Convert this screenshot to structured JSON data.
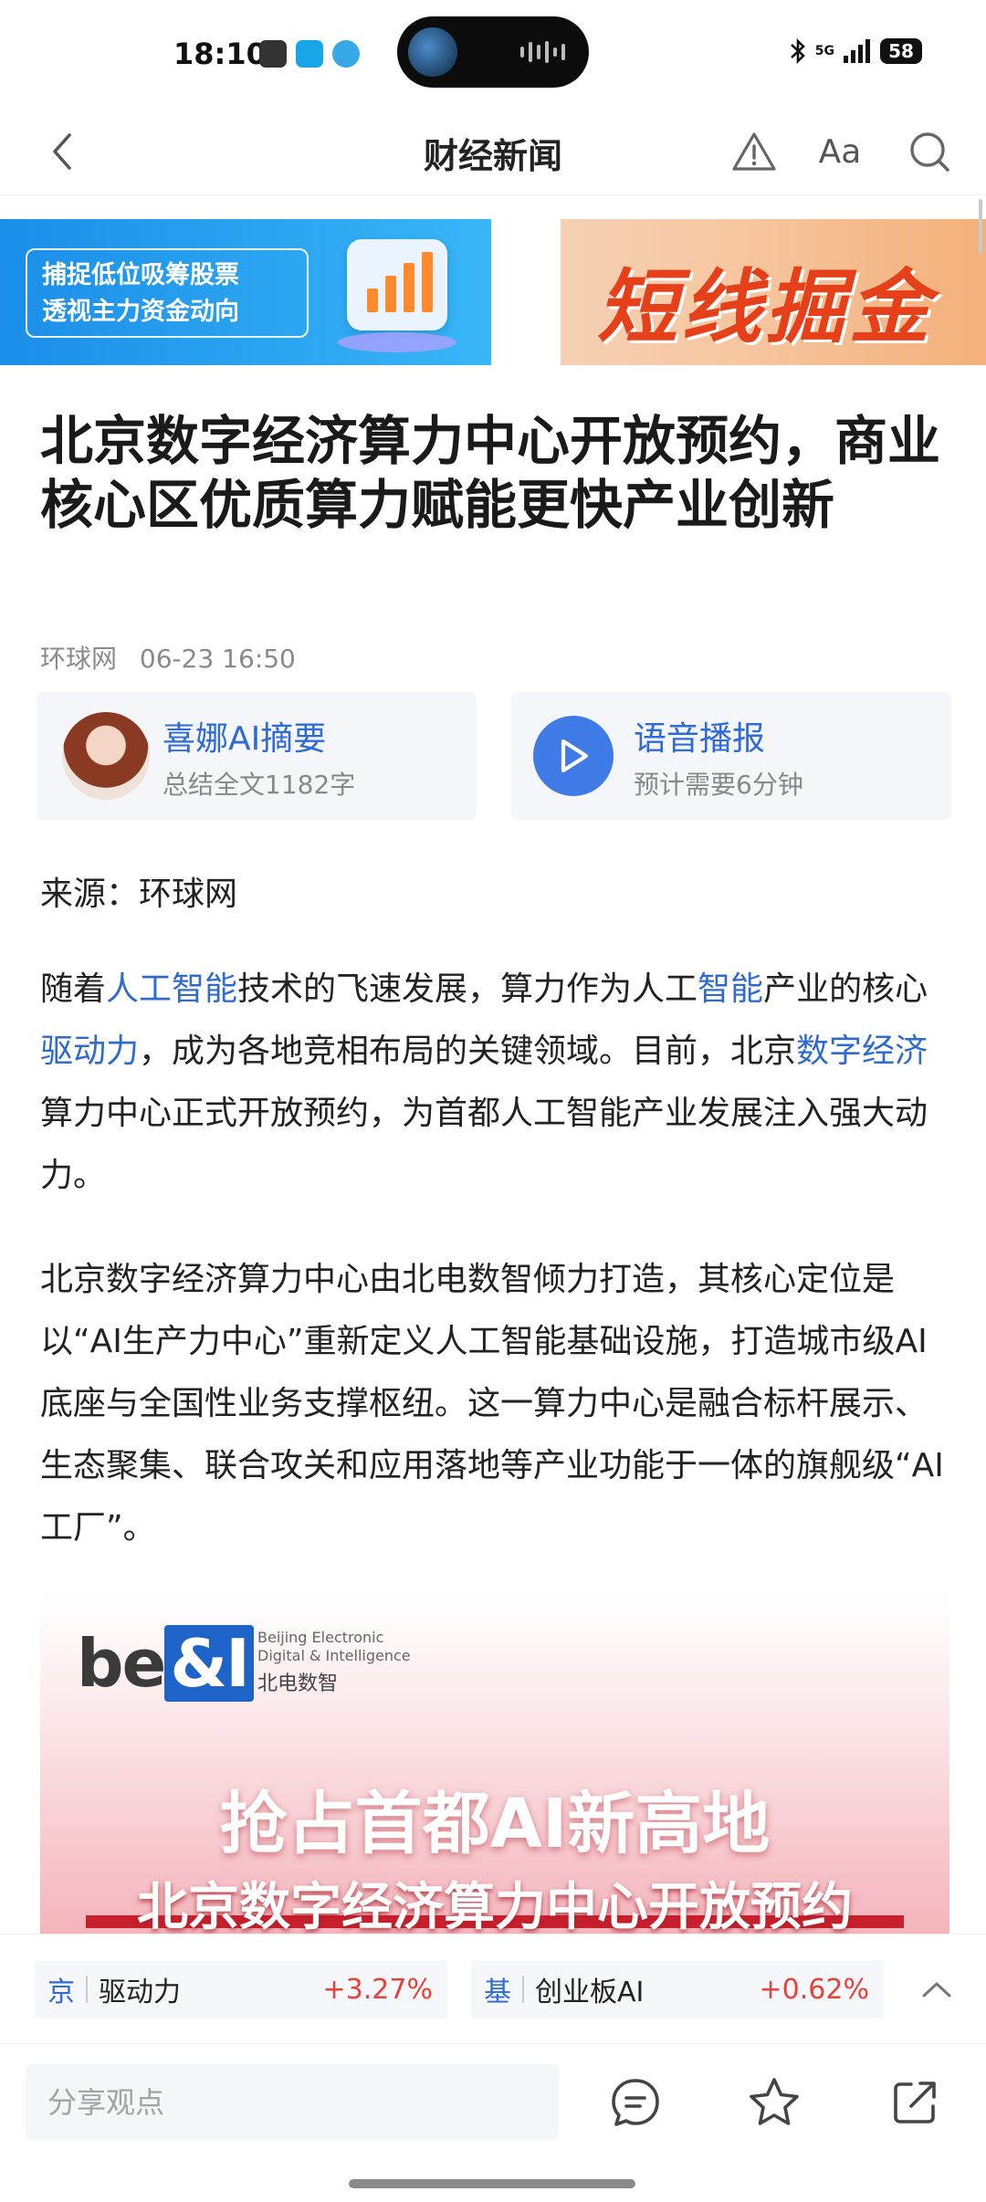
{
  "status_bar": {
    "time": "18:10",
    "network": "5G",
    "battery": "58",
    "icons": [
      "bluetooth-icon",
      "signal-icon",
      "battery-icon"
    ]
  },
  "nav": {
    "title": "财经新闻",
    "aa_label": "Aa",
    "icons": [
      "back-icon",
      "warning-icon",
      "search-icon"
    ]
  },
  "banners": [
    {
      "lines": [
        "捕捉低位吸筹股票",
        "透视主力资金动向"
      ],
      "bg": "#1b8ee8"
    },
    {
      "text": "短线掘金",
      "color": "#e6401b"
    }
  ],
  "article": {
    "headline": "北京数字经济算力中心开放预约，商业核心区优质算力赋能更快产业创新",
    "source_site": "环球网",
    "date": "06-23 16:50",
    "ai_card": {
      "title": "喜娜AI摘要",
      "subtitle": "总结全文1182字"
    },
    "voice_card": {
      "title": "语音播报",
      "subtitle": "预计需要6分钟"
    },
    "source_line": "来源：环球网",
    "para1": {
      "segments": [
        {
          "t": "随着",
          "link": false
        },
        {
          "t": "人工智能",
          "link": true
        },
        {
          "t": "技术的飞速发展，算力作为人工",
          "link": false
        },
        {
          "t": "智能",
          "link": true
        },
        {
          "t": "产业的核心",
          "link": false
        },
        {
          "t": "驱动力",
          "link": true
        },
        {
          "t": "，成为各地竞相布局的关键领域。目前，北京",
          "link": false
        },
        {
          "t": "数字经济",
          "link": true
        },
        {
          "t": "算力中心正式开放预约，为首都人工智能产业发展注入强大动力。",
          "link": false
        }
      ]
    },
    "para2": "北京数字经济算力中心由北电数智倾力打造，其核心定位是以“AI生产力中心”重新定义人工智能基础设施，打造城市级AI底座与全国性业务支撑枢纽。这一算力中心是融合标杆展示、生态聚集、联合攻关和应用落地等产业功能于一体的旗舰级“AI工厂”。",
    "image": {
      "logo_text_1": "be",
      "logo_text_2": "&I",
      "logo_en": "Beijing Electronic\nDigital & Intelligence",
      "logo_cn": "北电数智",
      "headline": "抢占首都AI新高地",
      "subheadline": "北京数字经济算力中心开放预约"
    }
  },
  "stock_bar": {
    "items": [
      {
        "tag": "京",
        "name": "驱动力",
        "change": "+3.27%"
      },
      {
        "tag": "基",
        "name": "创业板AI",
        "change": "+0.62%"
      }
    ],
    "up_color": "#e8413a"
  },
  "bottom_bar": {
    "share_placeholder": "分享观点",
    "icons": [
      "comment-icon",
      "star-icon",
      "share-icon"
    ]
  },
  "colors": {
    "link": "#2f6bcf",
    "accent_blue": "#2e6bd9",
    "play_bg": "#3f7be6"
  }
}
